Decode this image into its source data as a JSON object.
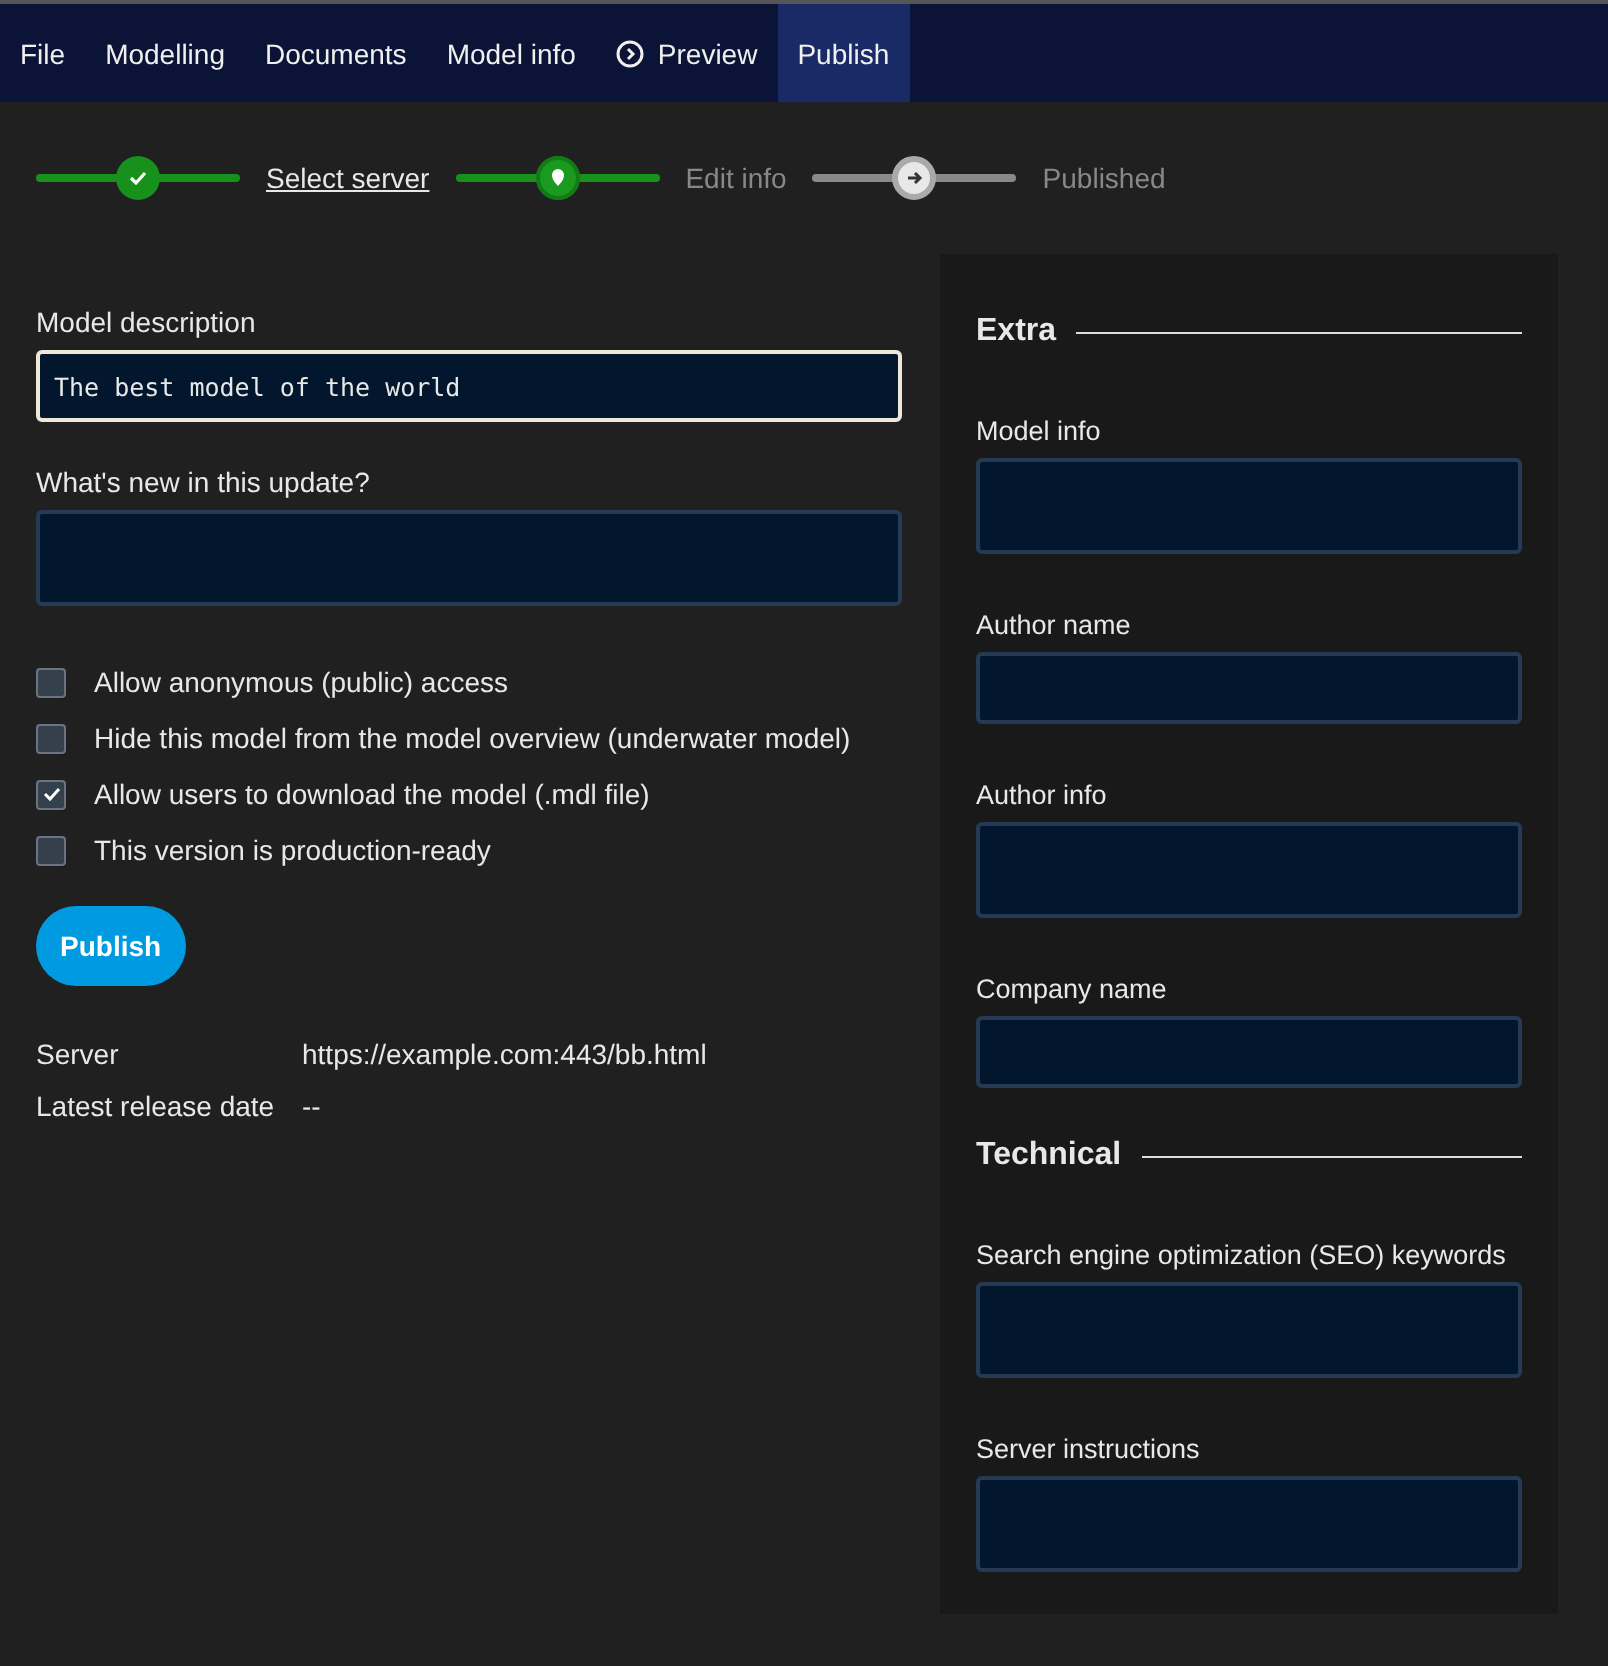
{
  "menu": [
    {
      "label": "File",
      "kind": "plain",
      "selected": false
    },
    {
      "label": "Modelling",
      "kind": "plain",
      "selected": false
    },
    {
      "label": "Documents",
      "kind": "plain",
      "selected": false
    },
    {
      "label": "Model info",
      "kind": "plain",
      "selected": false
    },
    {
      "label": "Preview",
      "kind": "with-icon",
      "selected": false
    },
    {
      "label": "Publish",
      "kind": "plain",
      "selected": true
    }
  ],
  "steps": [
    {
      "label": "Select server",
      "done": true,
      "current": false
    },
    {
      "label": "Edit info",
      "done": false,
      "current": true
    },
    {
      "label": "Published",
      "done": false,
      "current": false
    }
  ],
  "form": {
    "fields": [
      {
        "label": "Model description",
        "value": "The best model of the world",
        "focused": true
      },
      {
        "label": "What's new in this update?",
        "focused": false
      }
    ],
    "checkboxes": [
      {
        "label": "Allow anonymous (public) access",
        "checked": false
      },
      {
        "label": "Hide this model from the model overview (underwater model)",
        "checked": false
      },
      {
        "label": "Allow users to download the model (.mdl file)",
        "checked": true
      },
      {
        "label": "This version is production-ready",
        "checked": false
      }
    ],
    "publish_button": "Publish",
    "info": [
      {
        "label": "Server",
        "value": "https://example.com:443/bb.html"
      },
      {
        "label": "Latest release date",
        "value": "--"
      }
    ]
  },
  "side_panel": {
    "sections": [
      {
        "title": "Extra",
        "fields": [
          {
            "label": "Model info",
            "kind": "tall"
          },
          {
            "label": "Author name",
            "kind": "short"
          },
          {
            "label": "Author info",
            "kind": "tall"
          },
          {
            "label": "Company name",
            "kind": "short"
          }
        ]
      },
      {
        "title": "Technical",
        "fields": [
          {
            "label": "Search engine optimization (SEO) keywords",
            "kind": "tall"
          },
          {
            "label": "Server instructions",
            "kind": "tall"
          }
        ]
      }
    ]
  }
}
